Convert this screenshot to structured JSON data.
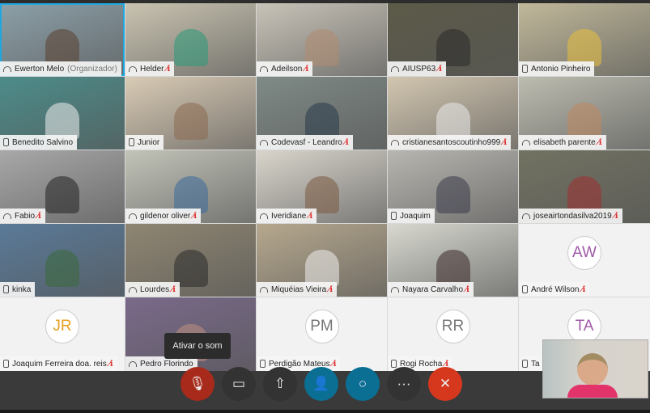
{
  "participants": [
    {
      "name": "Ewerton Melo",
      "role": "(Organizador)",
      "icon": "headset-icon",
      "muted": false,
      "active": true,
      "bg": "#8ca0a8",
      "skin": "#5a4030"
    },
    {
      "name": "Helder",
      "icon": "headset-video-icon",
      "muted": true,
      "bg": "#c9c3b0",
      "skin": "#2a9a7a"
    },
    {
      "name": "Adeilson",
      "icon": "headset-icon",
      "muted": true,
      "bg": "#c8c3b8",
      "skin": "#b08a70"
    },
    {
      "name": "AIUSP63",
      "icon": "headset-icon",
      "muted": true,
      "bg": "#5c5a48",
      "skin": "#2a2a2a"
    },
    {
      "name": "Antonio Pinheiro",
      "icon": "device-icon",
      "muted": false,
      "bg": "#c0b89a",
      "skin": "#e8c040"
    },
    {
      "name": "Benedito Salvino",
      "icon": "device-icon",
      "muted": false,
      "bg": "#4c8c8a",
      "skin": "#eeeeee"
    },
    {
      "name": "Junior",
      "icon": "device-icon",
      "muted": false,
      "bg": "#d9cbb5",
      "skin": "#8a6a50"
    },
    {
      "name": "Codevasf - Leandro",
      "icon": "headset-icon",
      "muted": true,
      "bg": "#7f8a86",
      "skin": "#2a3a4a"
    },
    {
      "name": "cristianesantoscoutinho999",
      "icon": "headset-icon",
      "muted": true,
      "bg": "#d2c6b0",
      "skin": "#eaeaea"
    },
    {
      "name": "elisabeth parente",
      "icon": "headset-icon",
      "muted": true,
      "bg": "#bcbcb0",
      "skin": "#c08860"
    },
    {
      "name": "Fabio",
      "icon": "headset-icon",
      "muted": true,
      "bg": "#a8a8a8",
      "skin": "#222222"
    },
    {
      "name": "gildenor oliver",
      "icon": "headset-icon",
      "muted": true,
      "bg": "#c2c3b8",
      "skin": "#3a6a9a"
    },
    {
      "name": "Iveridiane",
      "icon": "headset-icon",
      "muted": true,
      "bg": "#d9d5cc",
      "skin": "#7a5a40"
    },
    {
      "name": "Joaquim",
      "icon": "device-icon",
      "muted": false,
      "bg": "#b8b6b0",
      "skin": "#3a3a4a"
    },
    {
      "name": "joseairtondasilva2019",
      "icon": "headset-icon",
      "muted": true,
      "bg": "#727262",
      "skin": "#a03030"
    },
    {
      "name": "kinka",
      "icon": "device-icon",
      "muted": false,
      "bg": "#5a7a98",
      "skin": "#3a6a3a"
    },
    {
      "name": "Lourdes",
      "icon": "headset-icon",
      "muted": true,
      "bg": "#8f8672",
      "skin": "#2a2a2a"
    },
    {
      "name": "Miquéias Vieira",
      "icon": "headset-icon",
      "muted": true,
      "bg": "#b6a88e",
      "skin": "#eeeeee"
    },
    {
      "name": "Nayara Carvalho",
      "icon": "headset-icon",
      "muted": true,
      "bg": "#d8d8d0",
      "skin": "#3a2a2a"
    },
    {
      "name": "André Wilson",
      "icon": "device-icon",
      "muted": true,
      "initials": "AW",
      "initials_color": "#a05aa8"
    },
    {
      "name": "Joaquim Ferreira doa. reis",
      "icon": "device-icon",
      "muted": true,
      "initials": "JR",
      "initials_color": "#e8a020"
    },
    {
      "name": "Pedro Florindo",
      "icon": "headset-icon",
      "muted": false,
      "bg": "#7a6a8a",
      "skin": "#c09080"
    },
    {
      "name": "Perdigão Mateus",
      "icon": "device-icon",
      "muted": true,
      "initials": "PM",
      "initials_color": "#777777"
    },
    {
      "name": "Rogi Rocha",
      "icon": "device-icon",
      "muted": true,
      "initials": "RR",
      "initials_color": "#777777"
    },
    {
      "name": "Ta",
      "icon": "device-icon",
      "muted": false,
      "initials": "TA",
      "initials_color": "#a05aa8"
    }
  ],
  "tooltip": "Ativar o som",
  "toolbar": {
    "buttons": [
      {
        "name": "unmute-button",
        "icon": "mic-muted-icon",
        "glyph": "🎙",
        "bg": "#a82a1a"
      },
      {
        "name": "video-button",
        "icon": "video-off-icon",
        "glyph": "▭",
        "bg": "#333333"
      },
      {
        "name": "share-button",
        "icon": "share-icon",
        "glyph": "⇧",
        "bg": "#333333"
      },
      {
        "name": "participants-button",
        "icon": "participants-icon",
        "glyph": "👤",
        "bg": "#0b6f94"
      },
      {
        "name": "chat-button",
        "icon": "chat-icon",
        "glyph": "○",
        "bg": "#0b6f94"
      },
      {
        "name": "more-button",
        "icon": "more-icon",
        "glyph": "···",
        "bg": "#333333"
      },
      {
        "name": "leave-button",
        "icon": "close-icon",
        "glyph": "✕",
        "bg": "#d6381e"
      }
    ]
  }
}
